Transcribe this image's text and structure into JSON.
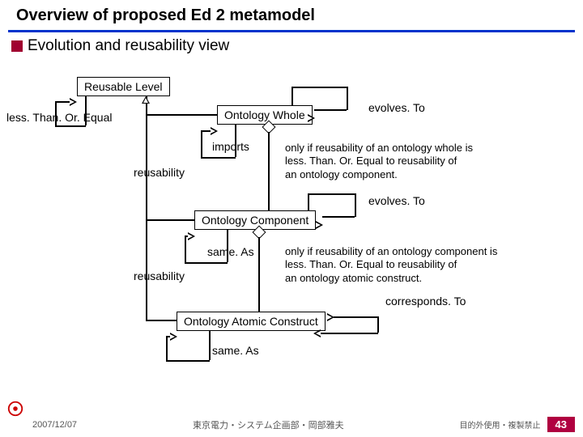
{
  "title": "Overview of proposed Ed 2 metamodel",
  "subtitle": "Evolution and reusability view",
  "boxes": {
    "reusable_level": "Reusable Level",
    "ontology_whole": "Ontology Whole",
    "ontology_component": "Ontology Component",
    "ontology_atomic": "Ontology Atomic Construct"
  },
  "labels": {
    "lessThanOrEqual": "less. Than. Or. Equal",
    "evolvesTo1": "evolves. To",
    "imports": "imports",
    "reusability1": "reusability",
    "evolvesTo2": "evolves. To",
    "sameAs1": "same. As",
    "reusability2": "reusability",
    "correspondsTo": "corresponds. To",
    "sameAs2": "same. As"
  },
  "notes": {
    "note1_l1": "only if reusability of an ontology whole is",
    "note1_l2": "less. Than. Or. Equal to reusability of",
    "note1_l3": "an ontology component.",
    "note2_l1": "only if reusability of an ontology component  is",
    "note2_l2": "less. Than. Or. Equal to reusability of",
    "note2_l3": "an ontology atomic construct."
  },
  "footer": {
    "date": "2007/12/07",
    "center": "東京電力・システム企画部・岡部雅夫",
    "right": "目的外使用・複製禁止",
    "page": "43"
  }
}
